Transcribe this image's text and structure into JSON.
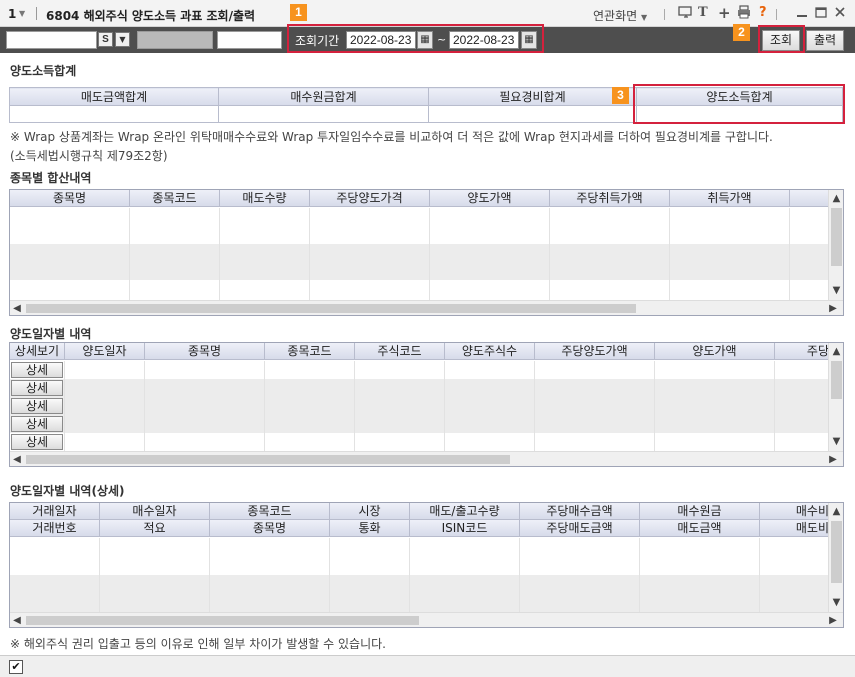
{
  "window": {
    "screen_number": "1",
    "title": "6804 해외주식 양도소득 과표 조회/출력",
    "related_screen": "연관화면",
    "icons": [
      "screen-link-icon",
      "text-icon",
      "plus-icon",
      "print-icon",
      "help-icon",
      "minimize-icon",
      "maximize-icon",
      "close-icon"
    ]
  },
  "annotations": [
    "1",
    "2",
    "3"
  ],
  "toolbar": {
    "s_button": "S",
    "period_label": "조회기간",
    "date_from": "2022-08-23",
    "date_to": "2022-08-23",
    "tilde": "~",
    "search_label": "조회",
    "print_label": "출력"
  },
  "summary": {
    "title": "양도소득합계",
    "headers": [
      "매도금액합계",
      "매수원금합계",
      "필요경비합계",
      "양도소득합계"
    ],
    "note_line1": "※ Wrap 상품계좌는 Wrap 온라인 위탁매매수수료와 Wrap 투자일임수수료를 비교하여 더 적은 값에 Wrap 현지과세를 더하여 필요경비계를 구합니다.",
    "note_line2": "(소득세법시행규칙 제79조2항)"
  },
  "by_stock": {
    "title": "종목별 합산내역",
    "headers": [
      "종목명",
      "종목코드",
      "매도수량",
      "주당양도가격",
      "양도가액",
      "주당취득가액",
      "취득가액"
    ]
  },
  "by_date": {
    "title": "양도일자별 내역",
    "headers": [
      "상세보기",
      "양도일자",
      "종목명",
      "종목코드",
      "주식코드",
      "양도주식수",
      "주당양도가액",
      "양도가액",
      "주당"
    ],
    "detail_buttons": [
      "상세",
      "상세",
      "상세",
      "상세",
      "상세"
    ]
  },
  "by_date_detail": {
    "title": "양도일자별 내역(상세)",
    "headers_row1": [
      "거래일자",
      "매수일자",
      "종목코드",
      "시장",
      "매도/출고수량",
      "주당매수금액",
      "매수원금",
      "매수비"
    ],
    "headers_row2": [
      "거래번호",
      "적요",
      "종목명",
      "통화",
      "ISIN코드",
      "주당매도금액",
      "매도금액",
      "매도비"
    ]
  },
  "footer_note": "※ 해외주식 권리 입출고 등의 이유로 인해 일부 차이가 발생할 수 있습니다.",
  "footer_checkbox_checked": true,
  "colors": {
    "toolbar_bg": "#4e4e4e",
    "header_bg": "#d7dbea",
    "highlight": "#d4213d",
    "badge": "#f7931e"
  }
}
